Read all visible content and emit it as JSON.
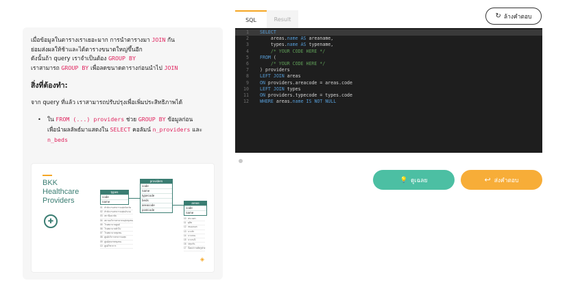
{
  "lesson": {
    "para1": {
      "l1_a": "เมื่อข้อมูลในตารางเราเยอะมาก การนำตารางมา ",
      "l1_code": "JOIN",
      "l1_b": " กัน",
      "l2": "ย่อมส่งผลให้ช้าและได้ตารางขนาดใหญ่ขึ้นอีก",
      "l3_a": "ดังนั้นถ้า query เราจำเป็นต้อง ",
      "l3_code": "GROUP BY",
      "l4_a": "เราสามารถ ",
      "l4_code1": "GROUP BY",
      "l4_b": " เพื่อลดขนาดตารางก่อนนำไป ",
      "l4_code2": "JOIN"
    },
    "heading": "สิ่งที่ต้องทำ:",
    "para2": "จาก query ที่แล้ว เราสามารถปรับปรุงเพื่อเพิ่มประสิทธิภาพได้",
    "bullet": {
      "a": "ใน ",
      "code1": "FROM (...) providers",
      "b": " ช่วย ",
      "code2": "GROUP BY",
      "c": " ข้อมูลก่อน",
      "d": "เพื่อนำผลลัพธ์มาแสดงใน ",
      "code3": "SELECT",
      "e": " คอลัมน์ ",
      "code4": "n_providers",
      "f": " และ",
      "code5": "n_beds"
    },
    "diagram": {
      "title_l1": "BKK",
      "title_l2": "Healthcare",
      "title_l3": "Providers",
      "types_table": {
        "title": "types",
        "rows": [
          "code",
          "name"
        ]
      },
      "providers_table": {
        "title": "providers",
        "rows": [
          "code",
          "name",
          "typecode",
          "beds",
          "areacode",
          "postcode"
        ]
      },
      "areas_table": {
        "title": "areas",
        "rows": [
          "code",
          "name"
        ]
      }
    }
  },
  "tabs": [
    "SQL",
    "Result"
  ],
  "reset_label": "ล้างคำตอบ",
  "editor": {
    "line_numbers": [
      "1",
      "2",
      "3",
      "4",
      "5",
      "6",
      "7",
      "8",
      "9",
      "10",
      "11",
      "12"
    ]
  },
  "buttons": {
    "solution": "ดูเฉลย",
    "submit": "ส่งคำตอบ"
  },
  "colors": {
    "solution": "#4cbfa3",
    "submit": "#f7ad38",
    "editor_bg": "#1e1e1e",
    "code_inline": "#e0245e",
    "brand_green": "#3a7d72"
  }
}
